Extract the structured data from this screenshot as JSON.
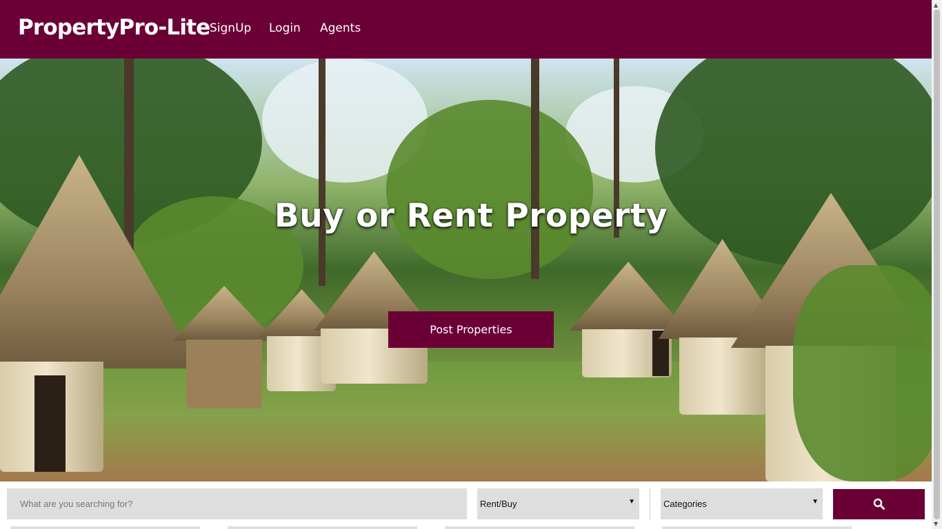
{
  "header": {
    "logo": "PropertyPro-Lite",
    "nav": {
      "signup": "SignUp",
      "login": "Login",
      "agents": "Agents"
    },
    "background_color": "#6b0036"
  },
  "hero": {
    "title": "Buy or Rent Property",
    "cta_label": "Post Properties",
    "background_image": "village-huts-forest-photo"
  },
  "search": {
    "placeholder": "What are you searching for?",
    "rent_buy_selected": "Rent/Buy",
    "categories_selected": "Categories",
    "button_icon": "search-icon"
  },
  "colors": {
    "accent": "#6b0036",
    "field_bg": "#dedede"
  }
}
